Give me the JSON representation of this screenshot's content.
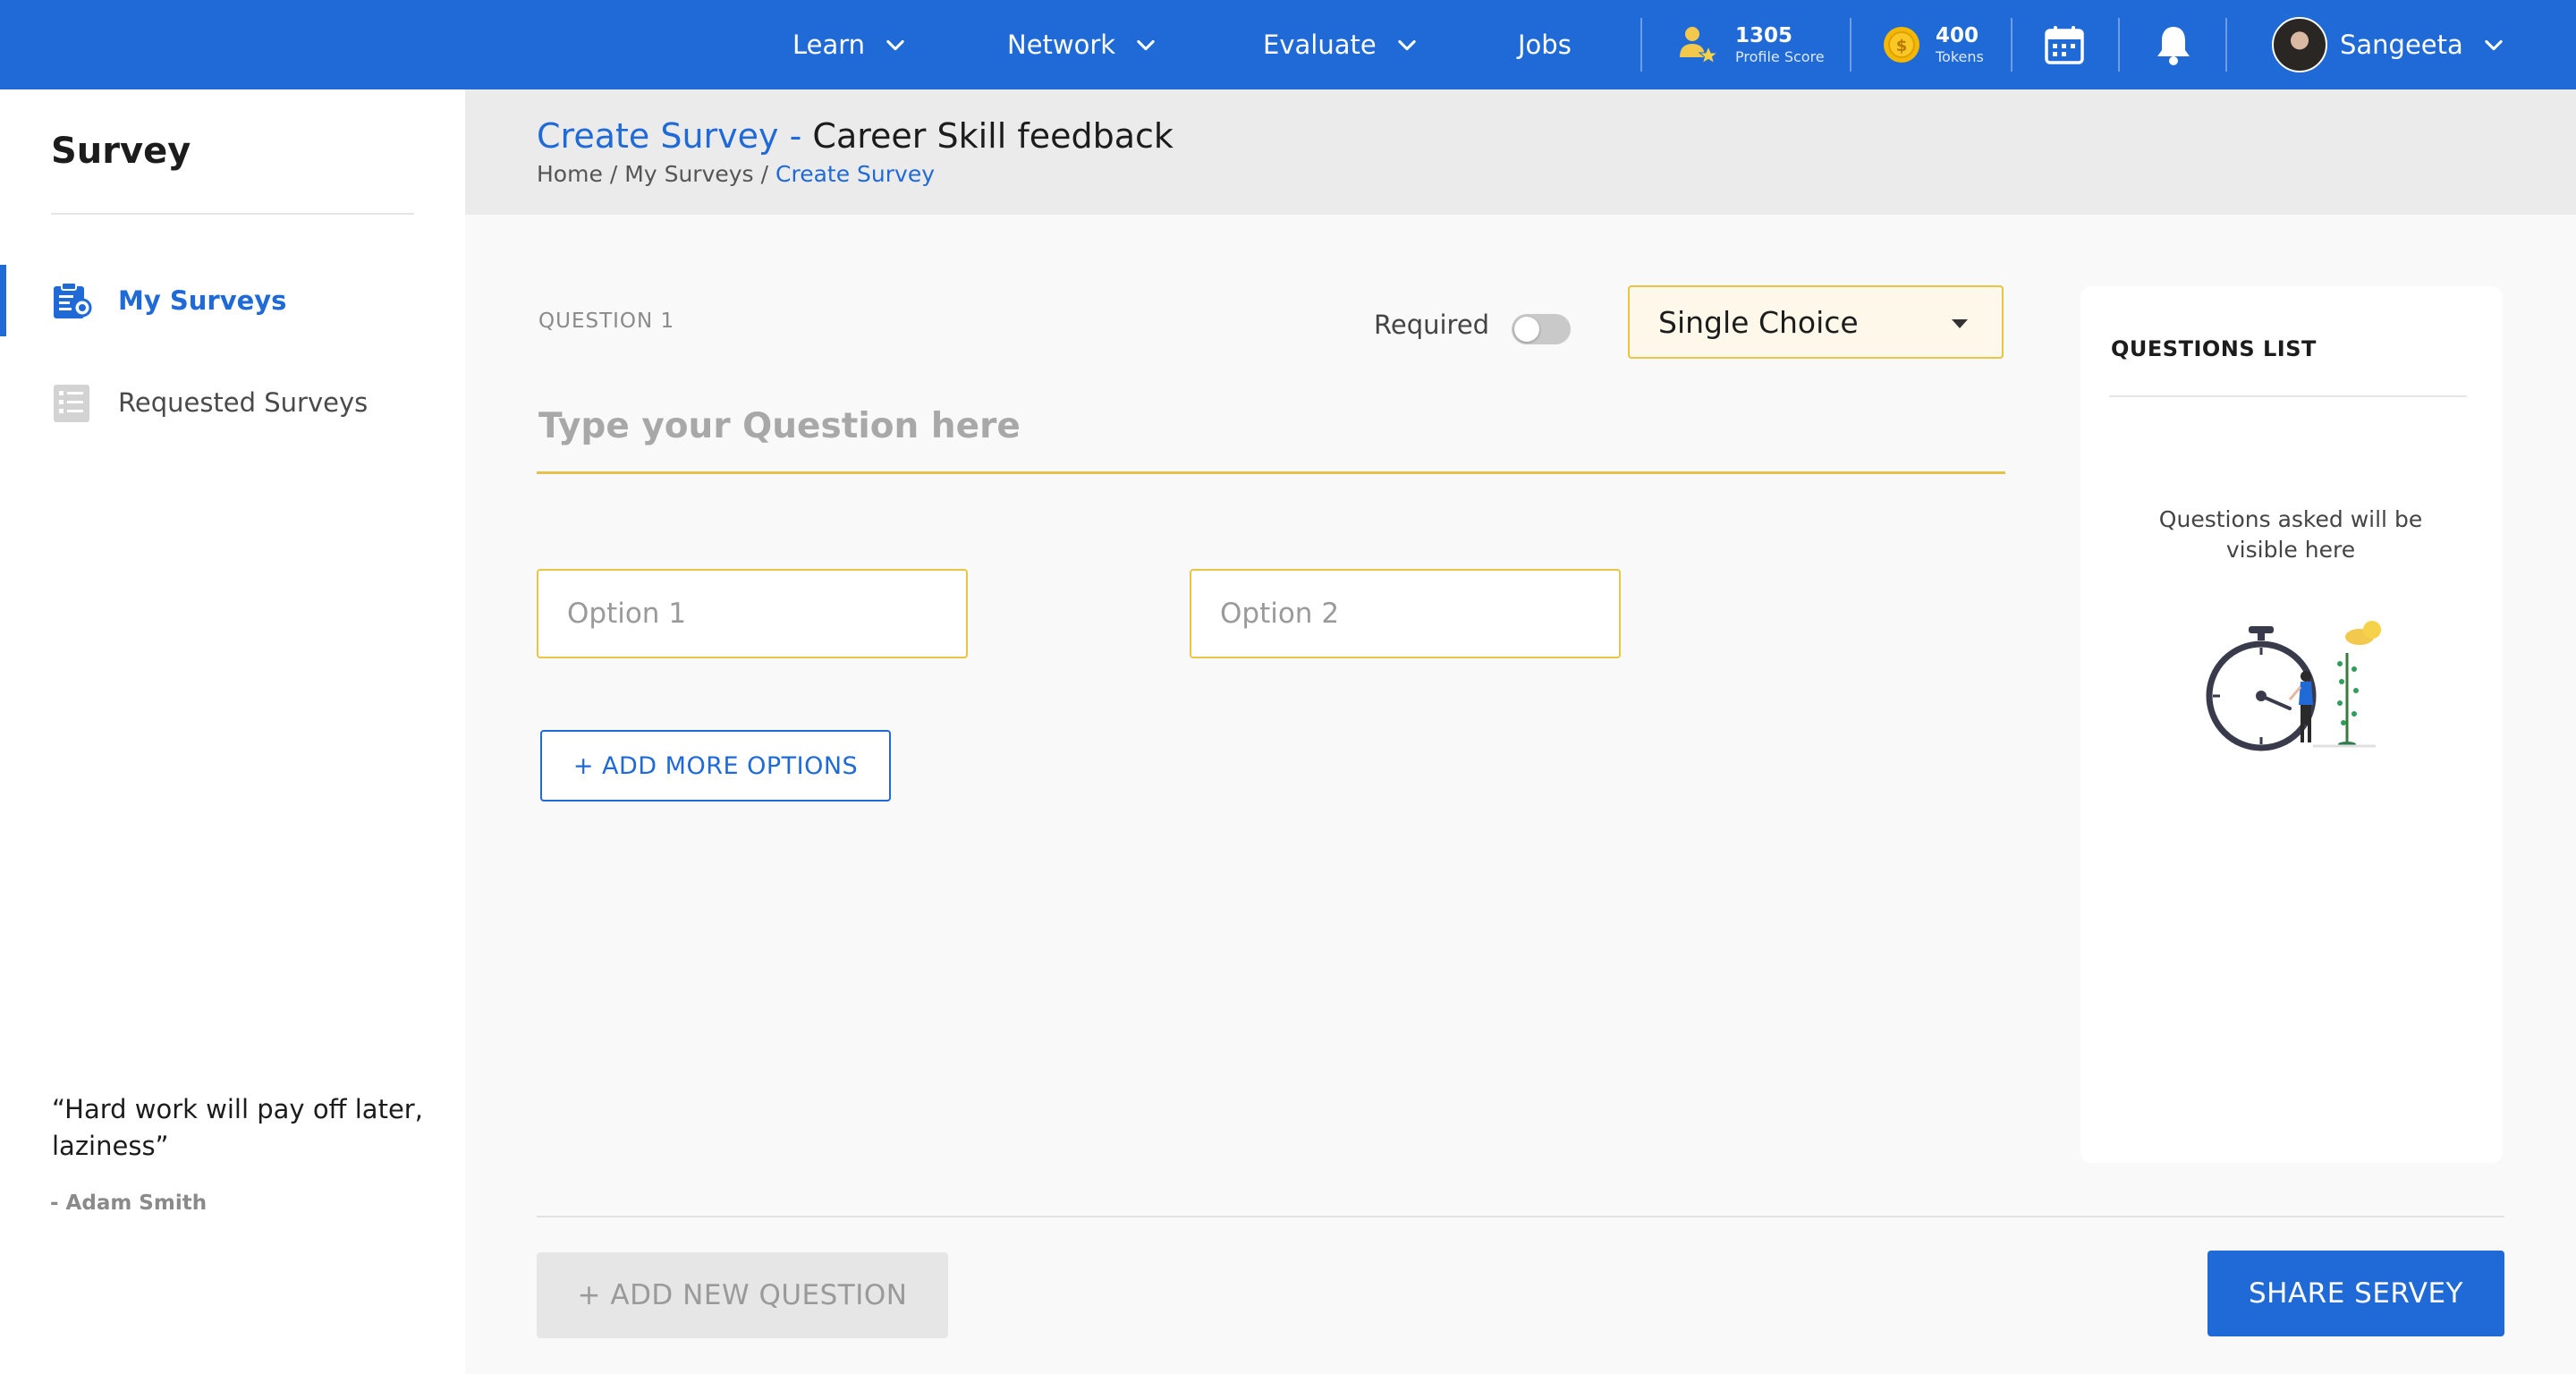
{
  "nav": {
    "items": [
      {
        "label": "Learn"
      },
      {
        "label": "Network"
      },
      {
        "label": "Evaluate"
      },
      {
        "label": "Jobs"
      }
    ],
    "profile_score": {
      "value": "1305",
      "label": "Profile Score"
    },
    "tokens": {
      "value": "400",
      "label": "Tokens"
    },
    "user_name": "Sangeeta"
  },
  "sidebar": {
    "title": "Survey",
    "items": [
      {
        "label": "My Surveys",
        "active": true
      },
      {
        "label": "Requested Surveys",
        "active": false
      }
    ],
    "quote": "“Hard work will pay off later, laziness”",
    "quote_author": "- Adam Smith"
  },
  "header": {
    "title_action": "Create Survey",
    "title_separator": " - ",
    "title_name": "Career Skill feedback",
    "breadcrumb": [
      "Home",
      "My Surveys",
      "Create Survey"
    ],
    "breadcrumb_sep": "/"
  },
  "question": {
    "label": "QUESTION 1",
    "required_label": "Required",
    "required": false,
    "type": "Single Choice",
    "placeholder": "Type your Question here",
    "value": "",
    "options": [
      {
        "placeholder": "Option 1",
        "value": ""
      },
      {
        "placeholder": "Option 2",
        "value": ""
      }
    ],
    "add_options_label": "+ ADD MORE OPTIONS"
  },
  "questions_list": {
    "title": "QUESTIONS LIST",
    "empty_text": "Questions asked will be visible here"
  },
  "footer": {
    "add_question_label": "+ ADD NEW QUESTION",
    "share_label": "SHARE SERVEY"
  },
  "colors": {
    "primary": "#1f6ad7",
    "accent_yellow": "#e9c544",
    "token_gold": "#f5b800"
  }
}
